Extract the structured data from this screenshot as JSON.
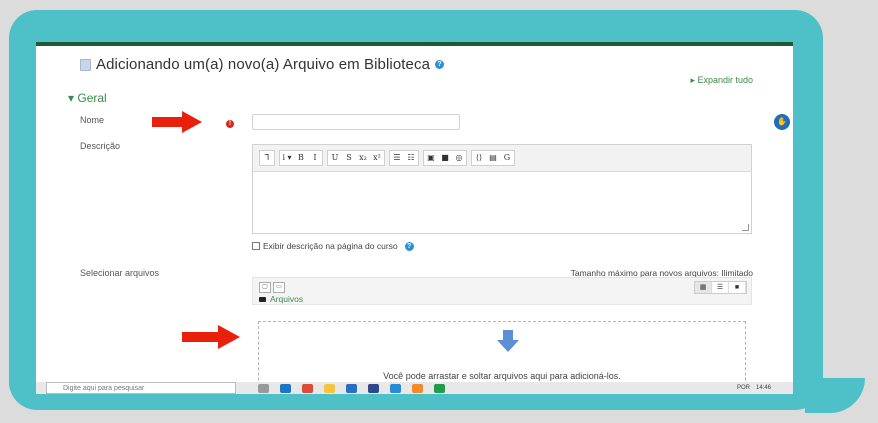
{
  "page": {
    "title": "Adicionando um(a) novo(a) Arquivo em Biblioteca",
    "expand_all": "▸ Expandir tudo",
    "section": "Geral"
  },
  "form": {
    "name_label": "Nome",
    "name_value": "",
    "description_label": "Descrição",
    "show_description": "Exibir descrição na página do curso",
    "select_files_label": "Selecionar arquivos",
    "max_size": "Tamanho máximo para novos arquivos: Ilimitado",
    "folder": "Arquivos",
    "drop_text": "Você pode arrastar e soltar arquivos aqui para adicioná-los."
  },
  "toolbar": {
    "groups": [
      [
        "⅂"
      ],
      [
        "i ▾",
        "B",
        "I"
      ],
      [
        "U",
        "S",
        "x₂",
        "x²"
      ],
      [
        "☰",
        "☷"
      ],
      [
        "▣",
        "■",
        "◎"
      ],
      [
        "⟨⟩",
        "▤",
        "G"
      ]
    ]
  },
  "filemanager": {
    "views": [
      "▦",
      "☰",
      "■"
    ]
  },
  "taskbar": {
    "search_placeholder": "Digite aqui para pesquisar",
    "lang": "POR",
    "time": "14:46"
  },
  "colors": {
    "bubble": "#4ec1c8",
    "accent_green": "#3a8a4a",
    "required": "#d9281e",
    "arrow": "#e8200c"
  }
}
